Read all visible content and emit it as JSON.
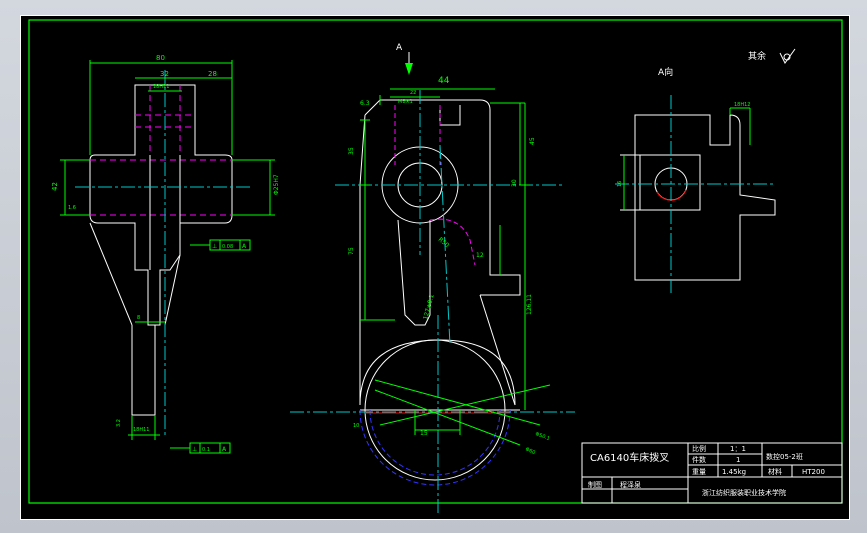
{
  "colors": {
    "background": "#000000",
    "geometry": "#ffffff",
    "dimension": "#00ff00",
    "centerline": "#00c8c8",
    "hidden": "#ff00ff",
    "accent_red": "#ff0000",
    "hidden_blue": "#3333ff",
    "cursor_marker": "#ffff00"
  },
  "views": {
    "arrow_label": "A",
    "a_view_label": "A向",
    "surface_note": "其余"
  },
  "dimensions": {
    "d80": "80",
    "d32": "32",
    "d28": "28",
    "d18h11": "18H11",
    "d42": "42",
    "d15": "1.6",
    "d25h7": "Φ25H7",
    "d44": "44",
    "d63": "6.3",
    "d22": "22",
    "dm8": "M8×1",
    "d35": "35",
    "d45": "45",
    "d30": "30",
    "d75": "75",
    "dr50": "R50",
    "d12": "12",
    "d127": "127±0.1",
    "d126": "126.11",
    "d15b": "15",
    "d10": "10",
    "dphi": "Φ50.1",
    "dphi2": "Φ60",
    "d8": "8",
    "d3": "3.2",
    "d18h11b": "18H11",
    "aview_w": "18H12",
    "aview_16": "16"
  },
  "tolerance_frames": [
    {
      "sym": "⊥",
      "val": "0.08",
      "ref": "A"
    },
    {
      "sym": "⊥",
      "val": "0.1",
      "ref": "A"
    }
  ],
  "title_block": {
    "part_name": "CA6140车床拨叉",
    "scale_label": "比例",
    "scale_value": "1：1",
    "qty_label": "件数",
    "qty_value": "1",
    "class_name": "数控05-2班",
    "weight_label": "重量",
    "weight_value": "1.45kg",
    "material_label": "材料",
    "material_value": "HT200",
    "drawn_label": "制图",
    "drawn_by": "程泽泉",
    "school": "浙江纺织服装职业技术学院"
  }
}
